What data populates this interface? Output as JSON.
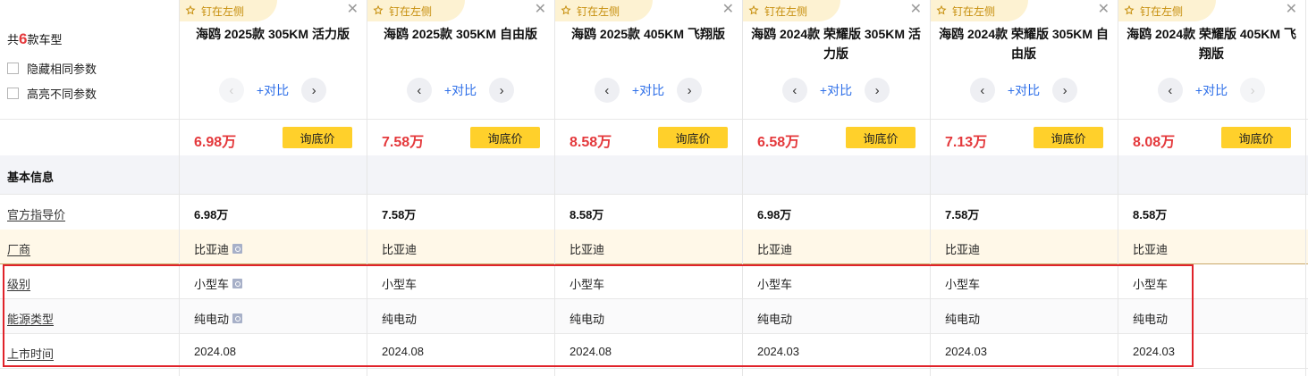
{
  "side": {
    "count_prefix": "共",
    "count_num": "6",
    "count_suffix": "款车型",
    "hide_same": "隐藏相同参数",
    "highlight_diff": "高亮不同参数"
  },
  "pin_label": "钉在左侧",
  "compare_label": "+对比",
  "ask_label": "询底价",
  "section_basic": "基本信息",
  "row_labels": {
    "msrp": "官方指导价",
    "maker": "厂商",
    "level": "级别",
    "energy": "能源类型",
    "launch": "上市时间"
  },
  "cars": [
    {
      "title": "海鸥 2025款 305KM 活力版",
      "price": "6.98万",
      "msrp": "6.98万",
      "maker": "比亚迪",
      "level": "小型车",
      "energy": "纯电动",
      "launch": "2024.08"
    },
    {
      "title": "海鸥 2025款 305KM 自由版",
      "price": "7.58万",
      "msrp": "7.58万",
      "maker": "比亚迪",
      "level": "小型车",
      "energy": "纯电动",
      "launch": "2024.08"
    },
    {
      "title": "海鸥 2025款 405KM 飞翔版",
      "price": "8.58万",
      "msrp": "8.58万",
      "maker": "比亚迪",
      "level": "小型车",
      "energy": "纯电动",
      "launch": "2024.08"
    },
    {
      "title": "海鸥 2024款 荣耀版 305KM 活力版",
      "price": "6.58万",
      "msrp": "6.98万",
      "maker": "比亚迪",
      "level": "小型车",
      "energy": "纯电动",
      "launch": "2024.03"
    },
    {
      "title": "海鸥 2024款 荣耀版 305KM 自由版",
      "price": "7.13万",
      "msrp": "7.58万",
      "maker": "比亚迪",
      "level": "小型车",
      "energy": "纯电动",
      "launch": "2024.03"
    },
    {
      "title": "海鸥 2024款 荣耀版 405KM 飞翔版",
      "price": "8.08万",
      "msrp": "8.58万",
      "maker": "比亚迪",
      "level": "小型车",
      "energy": "纯电动",
      "launch": "2024.03"
    }
  ],
  "colors": {
    "accent_price": "#e4393c",
    "ask_button": "#ffd02b",
    "compare_link": "#2e6fe8",
    "highlight_box": "#e0232a"
  }
}
